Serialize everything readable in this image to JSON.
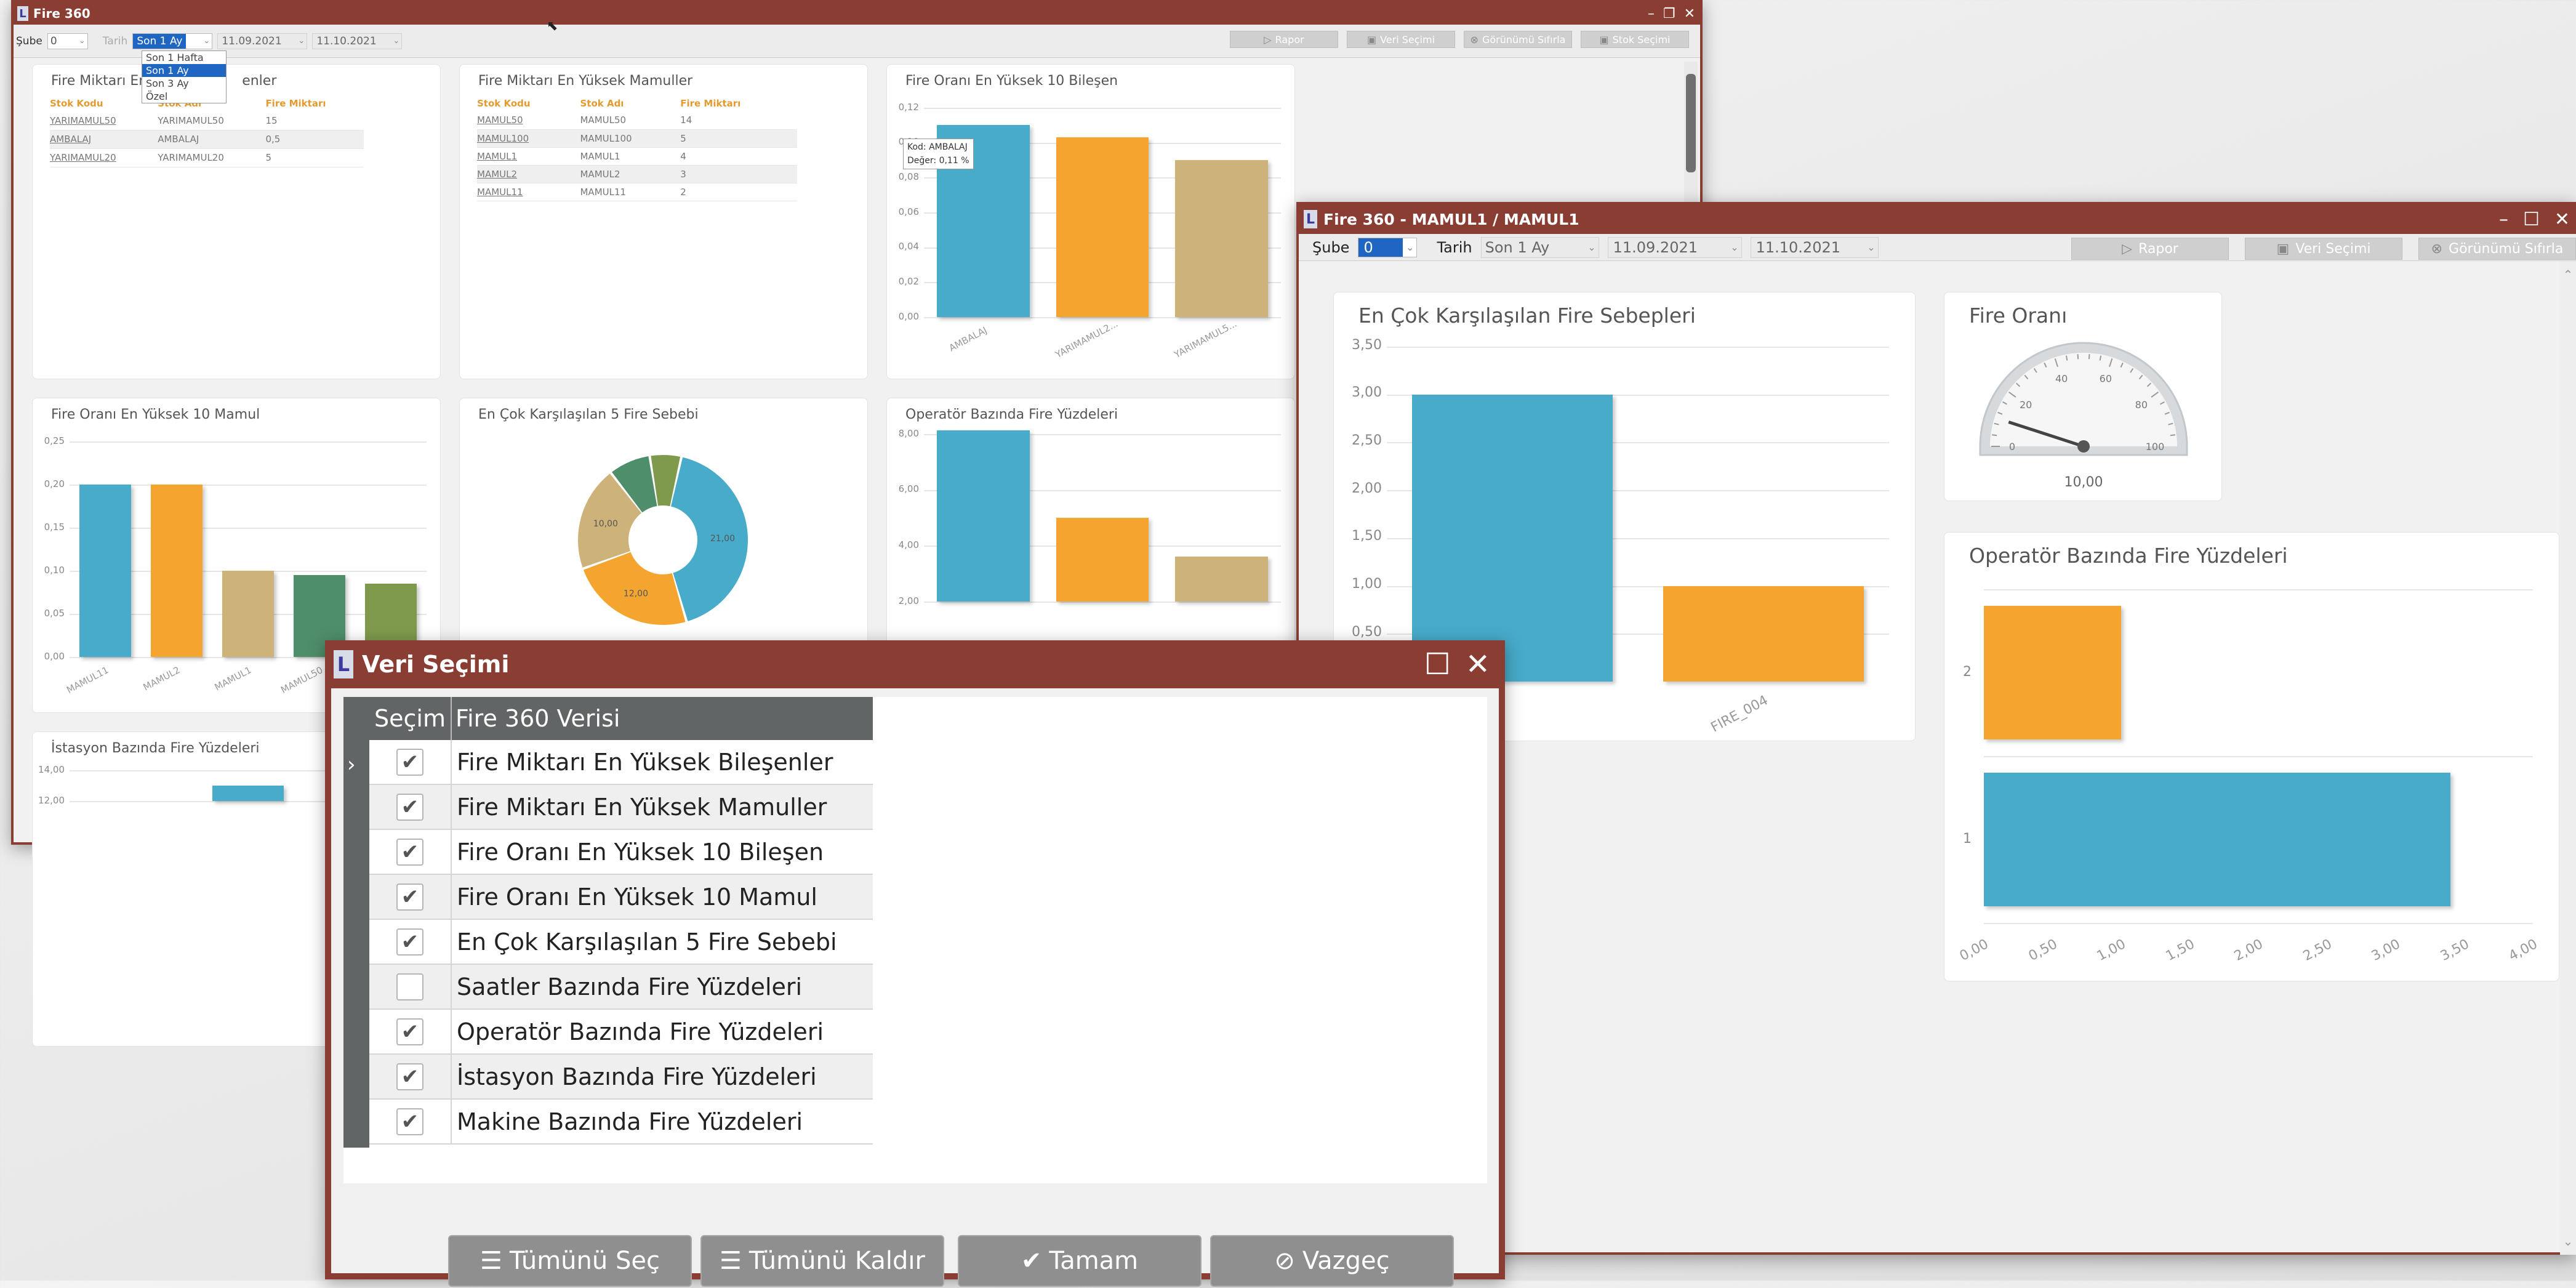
{
  "colors": {
    "title_bar": "#8a3e33",
    "blue": "#47abc9",
    "orange": "#f3a530",
    "tan": "#cdb37a",
    "green": "#4f8e6b",
    "olive": "#7f9a4d"
  },
  "win1": {
    "title": "Fire 360",
    "toolbar": {
      "sube_label": "Şube",
      "sube_value": "0",
      "tarih_label": "Tarih",
      "period": "Son 1 Ay",
      "start": "11.09.2021",
      "end": "11.10.2021",
      "buttons": [
        "Rapor",
        "Veri Seçimi",
        "Görünümü Sıfırla",
        "Stok Seçimi"
      ]
    },
    "dropdown": {
      "options": [
        "Son 1 Hafta",
        "Son 1 Ay",
        "Son 3 Ay",
        "Özel"
      ],
      "selected": "Son 1 Ay"
    },
    "panels": {
      "p1": {
        "title": "Fire Miktarı En Yüksek Bileşenler",
        "title_visible": "Fire Miktarı En",
        "title_tail": "enler",
        "headers": [
          "Stok Kodu",
          "Stok Adı",
          "Fire Miktarı"
        ],
        "rows": [
          [
            "YARIMAMUL50",
            "YARIMAMUL50",
            "15"
          ],
          [
            "AMBALAJ",
            "AMBALAJ",
            "0,5"
          ],
          [
            "YARIMAMUL20",
            "YARIMAMUL20",
            "5"
          ]
        ]
      },
      "p2": {
        "title": "Fire Miktarı En Yüksek Mamuller",
        "headers": [
          "Stok Kodu",
          "Stok Adı",
          "Fire Miktarı"
        ],
        "rows": [
          [
            "MAMUL50",
            "MAMUL50",
            "14"
          ],
          [
            "MAMUL100",
            "MAMUL100",
            "5"
          ],
          [
            "MAMUL1",
            "MAMUL1",
            "4"
          ],
          [
            "MAMUL2",
            "MAMUL2",
            "3"
          ],
          [
            "MAMUL11",
            "MAMUL11",
            "2"
          ]
        ]
      },
      "p3": {
        "title": "Fire Oranı En Yüksek 10 Bileşen",
        "tooltip_kod": "Kod: AMBALAJ",
        "tooltip_deger": "Değer: 0,11 %"
      },
      "p4": {
        "title": "Fire Oranı En Yüksek 10 Mamul"
      },
      "p5": {
        "title": "En Çok Karşılaşılan 5 Fire Sebebi"
      },
      "p6": {
        "title": "Operatör Bazında Fire Yüzdeleri"
      },
      "p7": {
        "title": "İstasyon Bazında Fire Yüzdeleri"
      }
    }
  },
  "win2": {
    "title": "Fire 360 - MAMUL1 / MAMUL1",
    "toolbar": {
      "sube_label": "Şube",
      "sube_value": "0",
      "tarih_label": "Tarih",
      "period": "Son 1 Ay",
      "start": "11.09.2021",
      "end": "11.10.2021",
      "buttons": [
        "Rapor",
        "Veri Seçimi",
        "Görünümü Sıfırla"
      ]
    },
    "panels": {
      "causes": {
        "title": "En Çok Karşılaşılan Fire Sebepleri"
      },
      "gauge": {
        "title": "Fire Oranı",
        "value_label": "10,00",
        "ticks": [
          "0",
          "20",
          "40",
          "60",
          "80",
          "100"
        ]
      },
      "operator": {
        "title": "Operatör Bazında Fire Yüzdeleri"
      }
    }
  },
  "dialog": {
    "title": "Veri Seçimi",
    "headers": [
      "Seçim",
      "Fire 360 Verisi"
    ],
    "rows": [
      {
        "label": "Fire Miktarı En Yüksek Bileşenler",
        "checked": true
      },
      {
        "label": "Fire Miktarı En Yüksek Mamuller",
        "checked": true
      },
      {
        "label": "Fire Oranı En Yüksek 10 Bileşen",
        "checked": true
      },
      {
        "label": "Fire Oranı En Yüksek 10 Mamul",
        "checked": true
      },
      {
        "label": "En Çok Karşılaşılan 5 Fire Sebebi",
        "checked": true
      },
      {
        "label": "Saatler Bazında Fire Yüzdeleri",
        "checked": false
      },
      {
        "label": "Operatör Bazında Fire Yüzdeleri",
        "checked": true
      },
      {
        "label": "İstasyon Bazında Fire Yüzdeleri",
        "checked": true
      },
      {
        "label": "Makine Bazında Fire Yüzdeleri",
        "checked": true
      }
    ],
    "buttons": {
      "select_all": "Tümünü Seç",
      "clear_all": "Tümünü Kaldır",
      "ok": "Tamam",
      "cancel": "Vazgeç"
    }
  },
  "chart_data": [
    {
      "id": "w1-bilesen",
      "type": "bar",
      "title": "Fire Oranı En Yüksek 10 Bileşen",
      "categories": [
        "AMBALAJ",
        "YARIMAMUL2...",
        "YARIMAMUL5..."
      ],
      "values": [
        0.11,
        0.103,
        0.09
      ],
      "ylim": [
        0,
        0.12
      ],
      "yticks": [
        "0,00",
        "0,02",
        "0,04",
        "0,06",
        "0,08",
        "0,10",
        "0,12"
      ],
      "colors": [
        "blue",
        "orange",
        "tan"
      ]
    },
    {
      "id": "w1-mamul",
      "type": "bar",
      "title": "Fire Oranı En Yüksek 10 Mamul",
      "categories": [
        "MAMUL11",
        "MAMUL2",
        "MAMUL1",
        "MAMUL50",
        ""
      ],
      "values": [
        0.2,
        0.2,
        0.1,
        0.095,
        0.085
      ],
      "ylim": [
        0,
        0.25
      ],
      "yticks": [
        "0,00",
        "0,05",
        "0,10",
        "0,15",
        "0,20",
        "0,25"
      ],
      "colors": [
        "blue",
        "orange",
        "tan",
        "green",
        "olive"
      ]
    },
    {
      "id": "w1-sebep",
      "type": "pie",
      "title": "En Çok Karşılaşılan 5 Fire Sebebi",
      "slices": [
        {
          "label": "21,00",
          "value": 21
        },
        {
          "label": "12,00",
          "value": 12
        },
        {
          "label": "10,00",
          "value": 10
        },
        {
          "label": "",
          "value": 4
        },
        {
          "label": "",
          "value": 3
        }
      ],
      "colors": [
        "blue",
        "orange",
        "tan",
        "green",
        "olive"
      ]
    },
    {
      "id": "w1-operator",
      "type": "bar",
      "title": "Operatör Bazında Fire Yüzdeleri",
      "categories": [
        "",
        "",
        ""
      ],
      "values": [
        8.2,
        5.0,
        3.6
      ],
      "ylim": [
        2,
        8
      ],
      "yticks": [
        "2,00",
        "4,00",
        "6,00",
        "8,00"
      ],
      "colors": [
        "blue",
        "orange",
        "tan"
      ]
    },
    {
      "id": "w1-istasyon",
      "type": "bar",
      "title": "İstasyon Bazında Fire Yüzdeleri",
      "categories": [
        ""
      ],
      "values": [
        13.0
      ],
      "ylim": [
        12,
        14
      ],
      "yticks": [
        "12,00",
        "14,00"
      ],
      "colors": [
        "blue"
      ]
    },
    {
      "id": "w2-causes",
      "type": "bar",
      "title": "En Çok Karşılaşılan Fire Sebepleri",
      "categories": [
        "",
        "FIRE_004"
      ],
      "values": [
        3.0,
        1.0
      ],
      "ylim": [
        0,
        3.5
      ],
      "yticks": [
        "0,50",
        "1,00",
        "1,50",
        "2,00",
        "2,50",
        "3,00",
        "3,50"
      ],
      "colors": [
        "blue",
        "orange"
      ]
    },
    {
      "id": "w2-operator",
      "type": "bar",
      "orientation": "horizontal",
      "title": "Operatör Bazında Fire Yüzdeleri",
      "categories": [
        "2",
        "1"
      ],
      "values": [
        1.0,
        3.4
      ],
      "xlim": [
        0,
        4
      ],
      "xticks": [
        "0,00",
        "0,50",
        "1,00",
        "1,50",
        "2,00",
        "2,50",
        "3,00",
        "3,50",
        "4,00"
      ],
      "colors": [
        "orange",
        "blue"
      ]
    },
    {
      "id": "w2-gauge",
      "type": "gauge",
      "title": "Fire Oranı",
      "value": 10,
      "range": [
        0,
        100
      ]
    }
  ]
}
